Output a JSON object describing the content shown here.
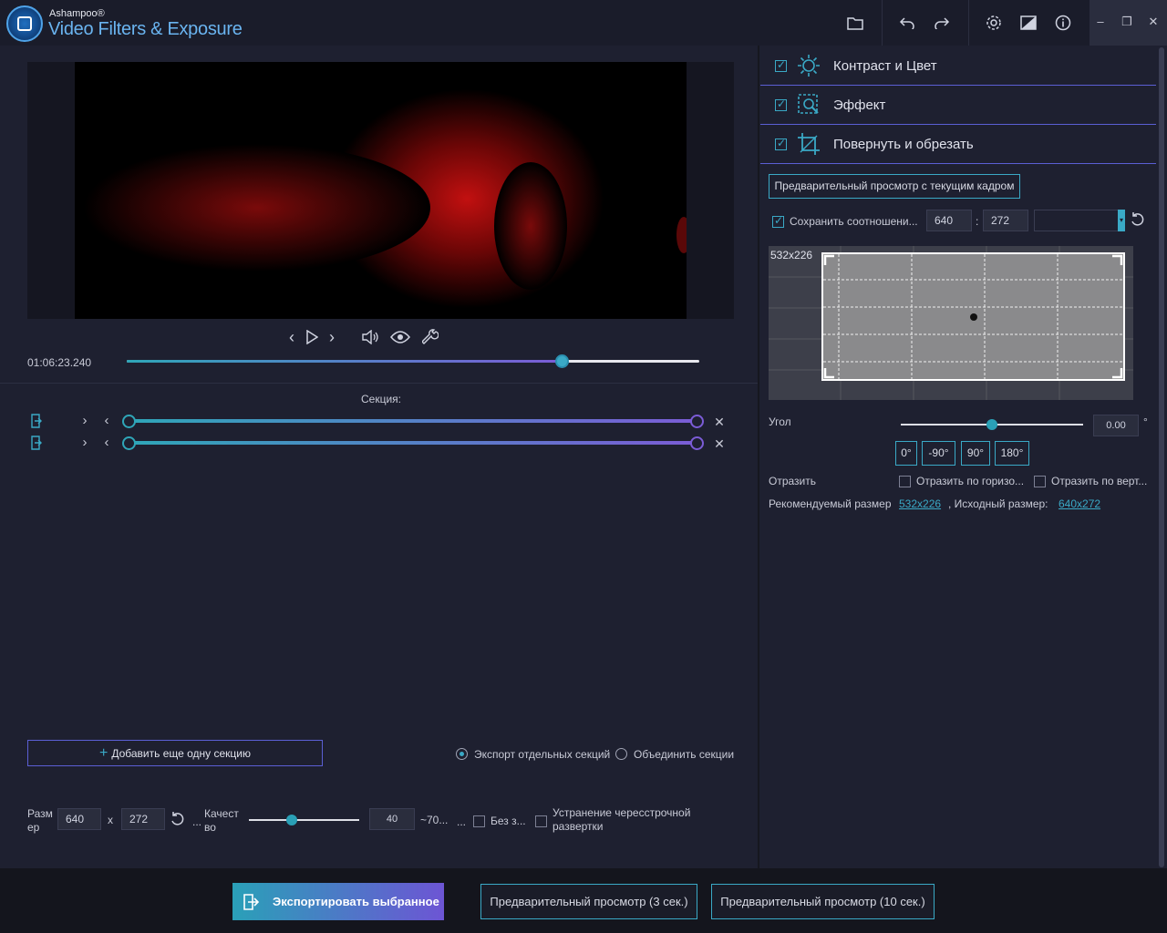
{
  "app": {
    "brand": "Ashampoo®",
    "title": "Video Filters & Exposure"
  },
  "player": {
    "timecode": "01:06:23.240",
    "progress_percent": 76
  },
  "sections": {
    "title": "Секция:",
    "rows": [
      {
        "start_percent": 0,
        "end_percent": 100
      },
      {
        "start_percent": 0,
        "end_percent": 100
      }
    ],
    "add_label": "Добавить еще одну секцию",
    "export_separate": "Экспорт отдельных секций",
    "merge": "Объединить секции"
  },
  "output": {
    "size_label": "Разм ер",
    "width": "640",
    "x": "x",
    "height": "272",
    "ellipsis": "...",
    "quality_label": "Качест во",
    "quality_value": "40",
    "quality_percent": 40,
    "approx": "~70...",
    "ellipsis2": "...",
    "no_sound": "Без з...",
    "deinterlace": "Устранение чересстрочной развертки"
  },
  "footer": {
    "export_label": "Экспортировать выбранное",
    "preview3": "Предварительный просмотр (3 сек.)",
    "preview10": "Предварительный просмотр (10 сек.)"
  },
  "filters": [
    {
      "label": "Контраст и Цвет",
      "checked": true,
      "icon": "sun-icon"
    },
    {
      "label": "Эффект",
      "checked": true,
      "icon": "effect-icon"
    },
    {
      "label": "Повернуть и обрезать",
      "checked": true,
      "icon": "crop-icon"
    }
  ],
  "crop": {
    "preview_frame": "Предварительный просмотр с текущим кадром",
    "keep_ratio": "Сохранить соотношени...",
    "width": "640",
    "colon": ":",
    "height": "272",
    "preset": "",
    "size_badge": "532x226",
    "angle_label": "Угол",
    "angle_value": "0.00",
    "degree": "°",
    "angle_buttons": [
      "0°",
      "-90°",
      "90°",
      "180°"
    ],
    "flip_label": "Отразить",
    "flip_h": "Отразить по горизо...",
    "flip_v": "Отразить по верт...",
    "recommended_label": "Рекомендуемый размер",
    "recommended_value": "532x226",
    "original_label": ", Исходный размер:",
    "original_value": "640x272"
  },
  "colors": {
    "accent": "#3aa9c6",
    "purple": "#5b5fd4",
    "background": "#1e2030"
  }
}
